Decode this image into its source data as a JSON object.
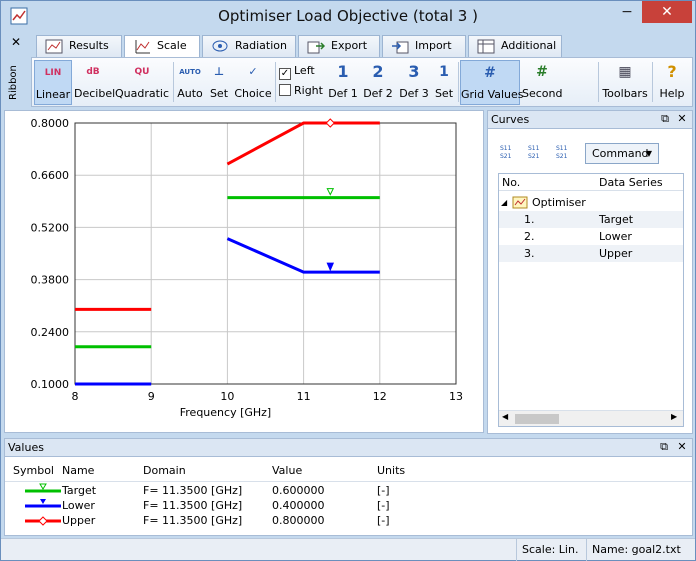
{
  "window": {
    "title": "Optimiser Load Objective (total 3 )",
    "minimize": "−",
    "maximize": "□",
    "close": "✕"
  },
  "tabs": [
    {
      "label": "Results",
      "icon": "results-icon"
    },
    {
      "label": "Scale",
      "icon": "scale-icon"
    },
    {
      "label": "Radiation",
      "icon": "radiation-icon"
    },
    {
      "label": "Export",
      "icon": "export-icon"
    },
    {
      "label": "Import",
      "icon": "import-icon"
    },
    {
      "label": "Additional",
      "icon": "additional-icon"
    }
  ],
  "ribbon": {
    "side_label": "Ribbon",
    "close": "✕",
    "buttons": {
      "linear": {
        "label": "Linear",
        "glyph": "LIN"
      },
      "decibel": {
        "label": "Decibel",
        "glyph": "dB"
      },
      "quadratic": {
        "label": "Quadratic",
        "glyph": "QU"
      },
      "auto": {
        "label": "Auto",
        "glyph": "AUTO"
      },
      "set1": {
        "label": "Set",
        "glyph": "⊥"
      },
      "choice": {
        "label": "Choice",
        "glyph": "✓"
      },
      "def1": {
        "label": "Def 1",
        "glyph": "1"
      },
      "def2": {
        "label": "Def 2",
        "glyph": "2"
      },
      "def3": {
        "label": "Def 3",
        "glyph": "3"
      },
      "set2": {
        "label": "Set",
        "glyph": "1"
      },
      "grid_values": {
        "label": "Grid Values",
        "glyph": "#"
      },
      "second": {
        "label": "Second",
        "glyph": "#"
      },
      "toolbars": {
        "label": "Toolbars",
        "glyph": "▦"
      },
      "help": {
        "label": "Help",
        "glyph": "?"
      }
    },
    "checks": {
      "left": {
        "label": "Left",
        "checked": true
      },
      "right": {
        "label": "Right",
        "checked": false
      }
    }
  },
  "chart_data": {
    "type": "line",
    "xlabel": "Frequency [GHz]",
    "ylabel": "",
    "xlim": [
      8,
      13
    ],
    "ylim": [
      0.1,
      0.8
    ],
    "xticks": [
      "8",
      "9",
      "10",
      "11",
      "12",
      "13"
    ],
    "yticks": [
      "0.1000",
      "0.2400",
      "0.3800",
      "0.5200",
      "0.6600",
      "0.8000"
    ],
    "grid": true,
    "series": [
      {
        "name": "Upper",
        "color": "#ff0000",
        "segments": [
          [
            [
              8,
              0.3
            ],
            [
              9,
              0.3
            ]
          ],
          [
            [
              10,
              0.69
            ],
            [
              11,
              0.8
            ],
            [
              12,
              0.8
            ]
          ]
        ],
        "marker": {
          "x": 11.35,
          "y": 0.8,
          "shape": "diamond"
        }
      },
      {
        "name": "Target",
        "color": "#00c000",
        "segments": [
          [
            [
              8,
              0.2
            ],
            [
              9,
              0.2
            ]
          ],
          [
            [
              10,
              0.6
            ],
            [
              12,
              0.6
            ]
          ]
        ],
        "marker": {
          "x": 11.35,
          "y": 0.6,
          "shape": "triangle-down-open"
        }
      },
      {
        "name": "Lower",
        "color": "#0000ff",
        "segments": [
          [
            [
              8,
              0.1
            ],
            [
              9,
              0.1
            ]
          ],
          [
            [
              10,
              0.49
            ],
            [
              11,
              0.4
            ],
            [
              12,
              0.4
            ]
          ]
        ],
        "marker": {
          "x": 11.35,
          "y": 0.4,
          "shape": "triangle-down"
        }
      }
    ]
  },
  "curves": {
    "title": "Curves",
    "command_label": "Command",
    "toolbar_icons": [
      "S11 S21",
      "S11 S21",
      "S11 S21"
    ],
    "columns": [
      "No.",
      "Data Series"
    ],
    "root": "Optimiser",
    "rows": [
      {
        "no": "1.",
        "series": "Target"
      },
      {
        "no": "2.",
        "series": "Lower"
      },
      {
        "no": "3.",
        "series": "Upper"
      }
    ]
  },
  "values": {
    "title": "Values",
    "columns": [
      "Symbol",
      "Name",
      "Domain",
      "Value",
      "Units"
    ],
    "rows": [
      {
        "name": "Target",
        "domain": "F= 11.3500 [GHz]",
        "value": "0.600000",
        "units": "[-]",
        "color": "#00c000"
      },
      {
        "name": "Lower",
        "domain": "F= 11.3500 [GHz]",
        "value": "0.400000",
        "units": "[-]",
        "color": "#0000ff"
      },
      {
        "name": "Upper",
        "domain": "F= 11.3500 [GHz]",
        "value": "0.800000",
        "units": "[-]",
        "color": "#ff0000"
      }
    ]
  },
  "status": {
    "scale": "Scale: Lin.",
    "name": "Name: goal2.txt"
  }
}
